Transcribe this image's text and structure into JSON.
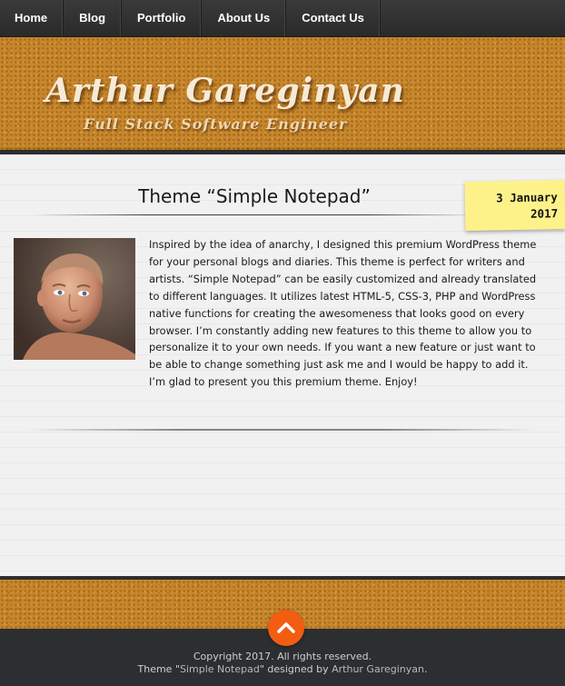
{
  "nav": {
    "items": [
      {
        "label": "Home"
      },
      {
        "label": "Blog"
      },
      {
        "label": "Portfolio"
      },
      {
        "label": "About Us"
      },
      {
        "label": "Contact Us"
      }
    ]
  },
  "header": {
    "title": "Arthur Gareginyan",
    "subtitle": "Full Stack Software Engineer"
  },
  "post": {
    "title": "Theme “Simple Notepad”",
    "date_line1": "3 January",
    "date_line2": "2017",
    "body": "Inspired by the idea of anarchy, I designed this premium WordPress theme for your personal blogs and diaries. This theme is perfect for writers and artists. “Simple Notepad” can be easily customized and already translated to different languages. It utilizes latest HTML-5, CSS-3, PHP and WordPress native functions for creating the awesomeness that looks good on every browser. I’m constantly adding new features to this theme to allow you to personalize it to your own needs. If you want a new feature or just want to be able to change something just ask me and I would be happy to add it. I’m glad to present you this premium theme. Enjoy!"
  },
  "footer": {
    "copyright": "Copyright 2017. All rights reserved.",
    "theme_prefix": "Theme \"",
    "theme_link": "Simple Notepad",
    "designed_by": "\" designed by ",
    "author_link": "Arthur Gareginyan",
    "suffix": "."
  },
  "icons": {
    "to_top": "chevron-up-icon"
  },
  "colors": {
    "accent": "#f25d12",
    "sticky_note": "#fdf28a",
    "cork": "#c8862a"
  }
}
